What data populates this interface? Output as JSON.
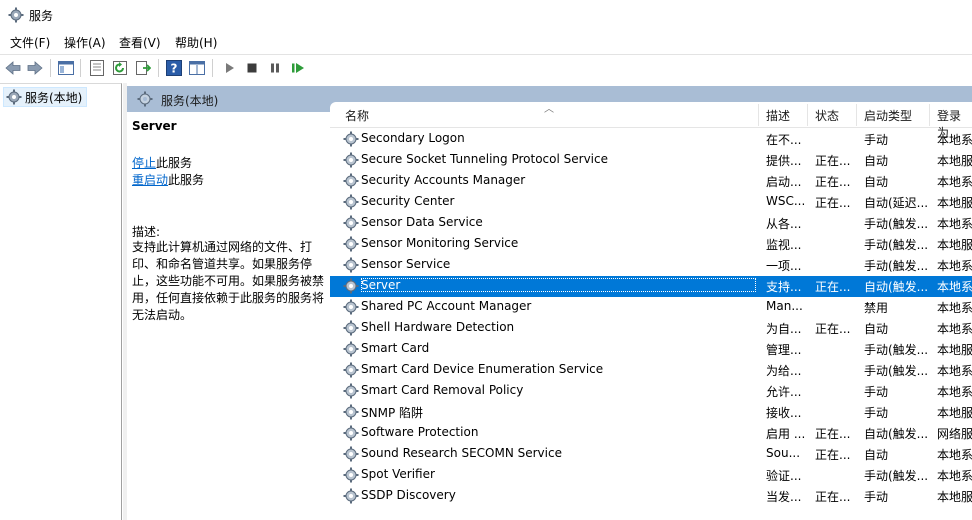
{
  "window": {
    "title": "服务"
  },
  "menu": [
    "文件(F)",
    "操作(A)",
    "查看(V)",
    "帮助(H)"
  ],
  "tree": {
    "root_label": "服务(本地)"
  },
  "pane": {
    "title": "服务(本地)"
  },
  "description": {
    "service_name": "Server",
    "stop_link": "停止",
    "stop_suffix": "此服务",
    "restart_link": "重启动",
    "restart_suffix": "此服务",
    "label": "描述:",
    "text": "支持此计算机通过网络的文件、打印、和命名管道共享。如果服务停止，这些功能不可用。如果服务被禁用，任何直接依赖于此服务的服务将无法启动。"
  },
  "columns": {
    "name": "名称",
    "desc": "描述",
    "status": "状态",
    "startup": "启动类型",
    "logon": "登录为"
  },
  "services": [
    {
      "name": "Secondary Logon",
      "desc": "在不...",
      "status": "",
      "startup": "手动",
      "logon": "本地系"
    },
    {
      "name": "Secure Socket Tunneling Protocol Service",
      "desc": "提供...",
      "status": "正在...",
      "startup": "自动",
      "logon": "本地服"
    },
    {
      "name": "Security Accounts Manager",
      "desc": "启动...",
      "status": "正在...",
      "startup": "自动",
      "logon": "本地系"
    },
    {
      "name": "Security Center",
      "desc": "WSC...",
      "status": "正在...",
      "startup": "自动(延迟...",
      "logon": "本地服"
    },
    {
      "name": "Sensor Data Service",
      "desc": "从各...",
      "status": "",
      "startup": "手动(触发...",
      "logon": "本地系"
    },
    {
      "name": "Sensor Monitoring Service",
      "desc": "监视...",
      "status": "",
      "startup": "手动(触发...",
      "logon": "本地服"
    },
    {
      "name": "Sensor Service",
      "desc": "一项...",
      "status": "",
      "startup": "手动(触发...",
      "logon": "本地系"
    },
    {
      "name": "Server",
      "desc": "支持...",
      "status": "正在...",
      "startup": "自动(触发...",
      "logon": "本地系",
      "selected": true
    },
    {
      "name": "Shared PC Account Manager",
      "desc": "Man...",
      "status": "",
      "startup": "禁用",
      "logon": "本地系"
    },
    {
      "name": "Shell Hardware Detection",
      "desc": "为自...",
      "status": "正在...",
      "startup": "自动",
      "logon": "本地系"
    },
    {
      "name": "Smart Card",
      "desc": "管理...",
      "status": "",
      "startup": "手动(触发...",
      "logon": "本地服"
    },
    {
      "name": "Smart Card Device Enumeration Service",
      "desc": "为给...",
      "status": "",
      "startup": "手动(触发...",
      "logon": "本地系"
    },
    {
      "name": "Smart Card Removal Policy",
      "desc": "允许...",
      "status": "",
      "startup": "手动",
      "logon": "本地系"
    },
    {
      "name": "SNMP 陷阱",
      "desc": "接收...",
      "status": "",
      "startup": "手动",
      "logon": "本地服"
    },
    {
      "name": "Software Protection",
      "desc": "启用 ...",
      "status": "正在...",
      "startup": "自动(触发...",
      "logon": "网络服"
    },
    {
      "name": "Sound Research SECOMN Service",
      "desc": "Sou...",
      "status": "正在...",
      "startup": "自动",
      "logon": "本地系"
    },
    {
      "name": "Spot Verifier",
      "desc": "验证...",
      "status": "",
      "startup": "手动(触发...",
      "logon": "本地系"
    },
    {
      "name": "SSDP Discovery",
      "desc": "当发...",
      "status": "正在...",
      "startup": "手动",
      "logon": "本地服"
    }
  ]
}
